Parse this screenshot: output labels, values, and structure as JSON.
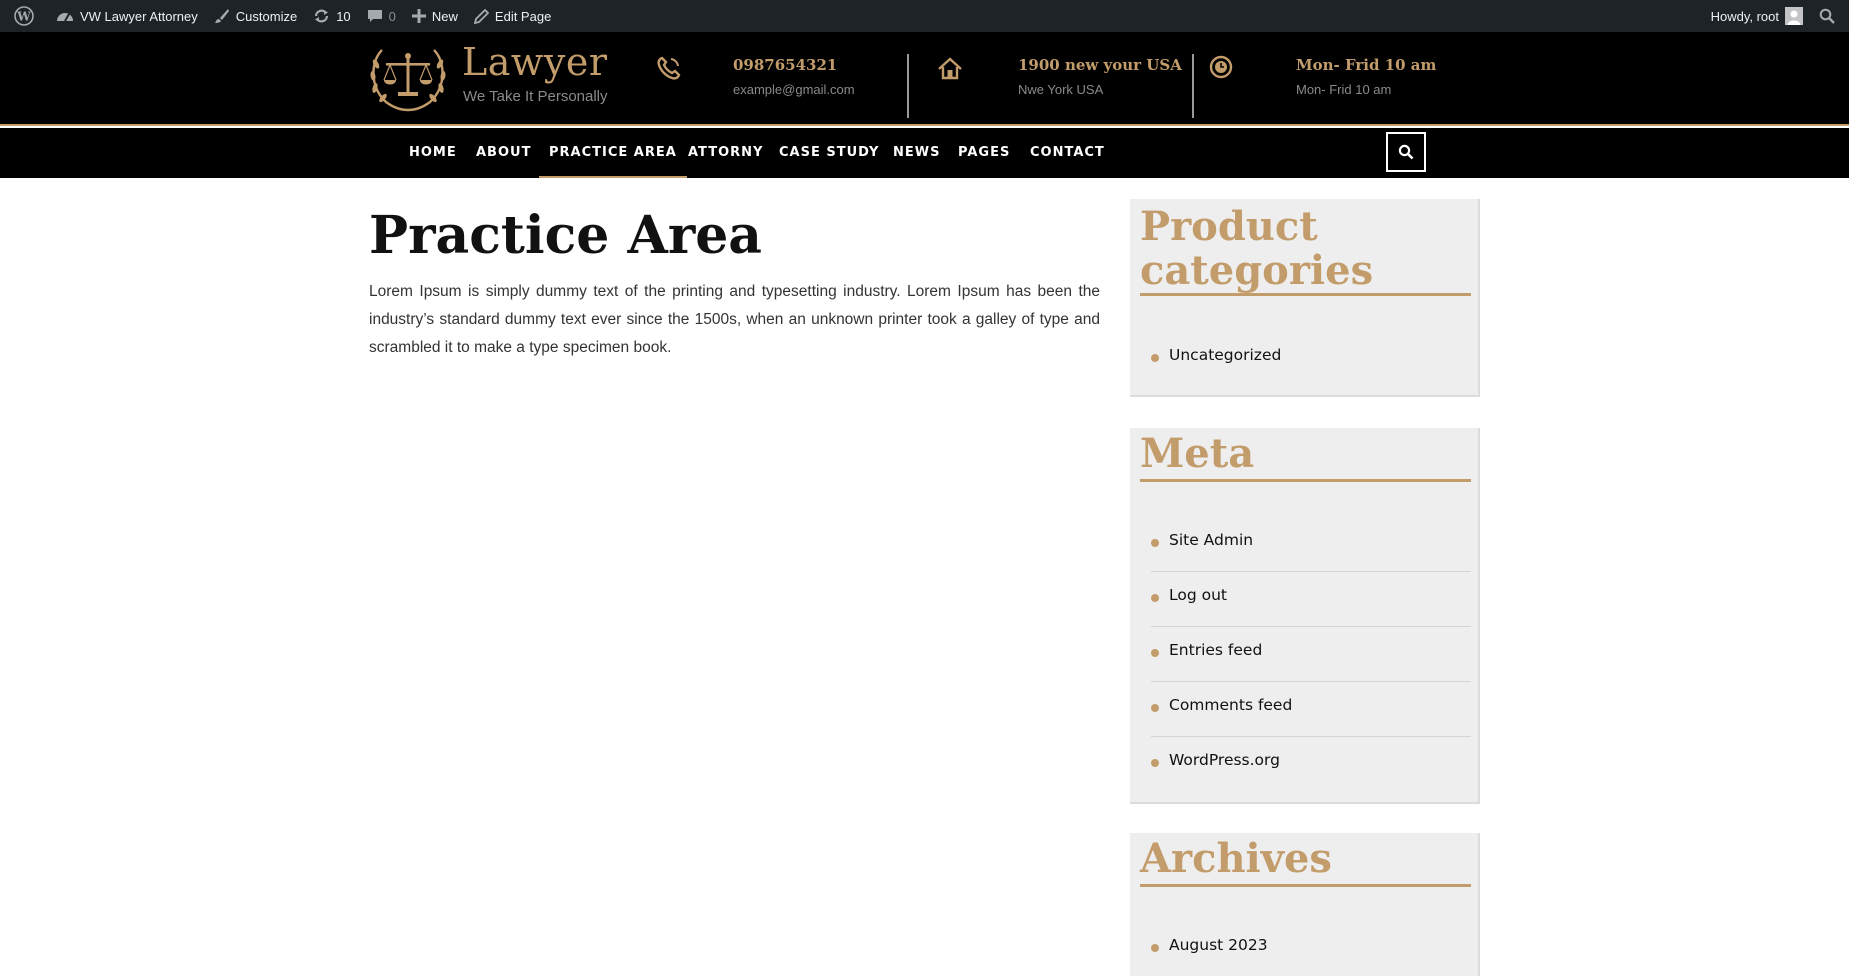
{
  "adminbar": {
    "site_name": "VW Lawyer Attorney",
    "customize": "Customize",
    "updates_count": "10",
    "comments_count": "0",
    "new_label": "New",
    "edit_page": "Edit Page",
    "greeting": "Howdy, root"
  },
  "header": {
    "title": "Lawyer",
    "tagline": "We Take It Personally",
    "phone": "0987654321",
    "email": "example@gmail.com",
    "address_main": "1900 new your USA",
    "address_sub": "Nwe York USA",
    "hours_main": "Mon- Frid 10 am",
    "hours_sub": "Mon- Frid 10 am"
  },
  "nav": {
    "items": [
      "HOME",
      "ABOUT",
      "PRACTICE AREA",
      "ATTORNY",
      "CASE STUDY",
      "NEWS",
      "PAGES",
      "CONTACT"
    ],
    "active": "PRACTICE AREA"
  },
  "main": {
    "title": "Practice Area",
    "body": "Lorem Ipsum is simply dummy text of the printing and typesetting industry. Lorem Ipsum has been the industry’s standard dummy text ever since the 1500s, when an unknown printer took a galley of type and scrambled it to make a type specimen book."
  },
  "sidebar": {
    "product_categories": {
      "title": "Product categories",
      "items": [
        "Uncategorized"
      ]
    },
    "meta": {
      "title": "Meta",
      "items": [
        "Site Admin",
        "Log out",
        "Entries feed",
        "Comments feed",
        "WordPress.org"
      ]
    },
    "archives": {
      "title": "Archives",
      "items": [
        "August 2023"
      ]
    }
  },
  "colors": {
    "accent": "#c39c6b",
    "header_bg": "#000000",
    "adminbar_bg": "#1d2327",
    "widget_bg": "#eeeeee"
  },
  "icons": [
    "wordpress-icon",
    "dashboard-icon",
    "brush-icon",
    "refresh-icon",
    "comment-icon",
    "plus-icon",
    "pencil-icon",
    "avatar-icon",
    "search-icon",
    "scales-of-justice-icon",
    "phone-icon",
    "home-icon",
    "clock-icon"
  ]
}
